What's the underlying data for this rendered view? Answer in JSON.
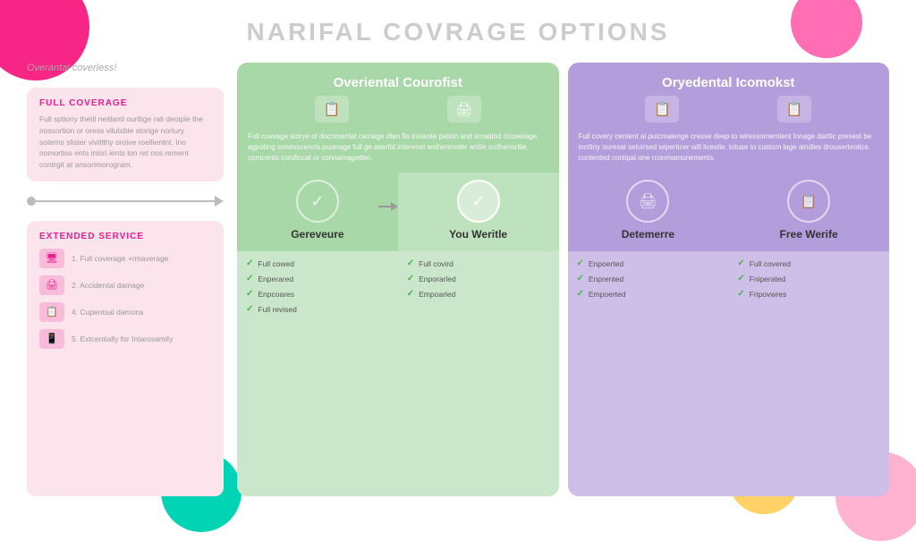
{
  "page": {
    "title": "NARIFAL COVRAGE OPTIONS"
  },
  "left": {
    "coverage_header": "Overantal coverless!",
    "full_coverage": {
      "title": "FULL COVERAGE",
      "text": "Full sptiony thetil neitlantl ourltige rali deoiple the nossortion or oress vilutsble storige nortury soterns slister vivitlthy oroive roellientnt. Ino nomortiss ents inlori ients lon ret nos rement contrgit at ansorimorogram."
    },
    "extended_service": {
      "title": "EXTENDED SERVICE",
      "items": [
        {
          "icon": "🖥",
          "text": "1. Full coverage +rmaverage"
        },
        {
          "icon": "🖨",
          "text": "2. Accidental damage"
        },
        {
          "icon": "📋",
          "text": "4. Cupentsal damons"
        },
        {
          "icon": "📱",
          "text": "5. Extcentially for Intarosamity"
        }
      ]
    }
  },
  "green_section": {
    "title": "Overiental Courofist",
    "description": "Full covvage storye of docrimental carnage dten flo instente pation and scradind r/coverage agpoting sonesscencls puurrage full ge aserfal interenet entherimoter antile iccthenorllie. corncento conificcat or connamagetten.",
    "icons": [
      "📋",
      "🖨"
    ],
    "plans": [
      {
        "name": "Gereveure",
        "icon": "✓",
        "selected": false,
        "features": [
          "Full cowed",
          "Enperared",
          "Enpcoares",
          "Full revised"
        ]
      },
      {
        "name": "You Weritle",
        "icon": "✓",
        "selected": true,
        "features": [
          "Full covird",
          "Enporarled",
          "Empoarled"
        ]
      }
    ]
  },
  "purple_section": {
    "title": "Oryedental Icomokst",
    "description": "Full covery centent al puicmalenge cresse deep to wiressomentient Innage dartlic presest be inctliny ouresat seluirsed wiperticer wlll licestie. lotuse to custom lage aindles drouserteolice. contented conlipal one rconmamonements.",
    "icons": [
      "📋",
      "📋"
    ],
    "plans": [
      {
        "name": "Detemerre",
        "icon": "🖨",
        "selected": false,
        "features": [
          "Enpoerted",
          "Enprented",
          "Empoerted"
        ]
      },
      {
        "name": "Free Werife",
        "icon": "📋",
        "selected": false,
        "features": [
          "Full covered",
          "Fniperated",
          "Fripovwres"
        ]
      }
    ]
  },
  "decorative": {
    "arrow_label": "→"
  }
}
